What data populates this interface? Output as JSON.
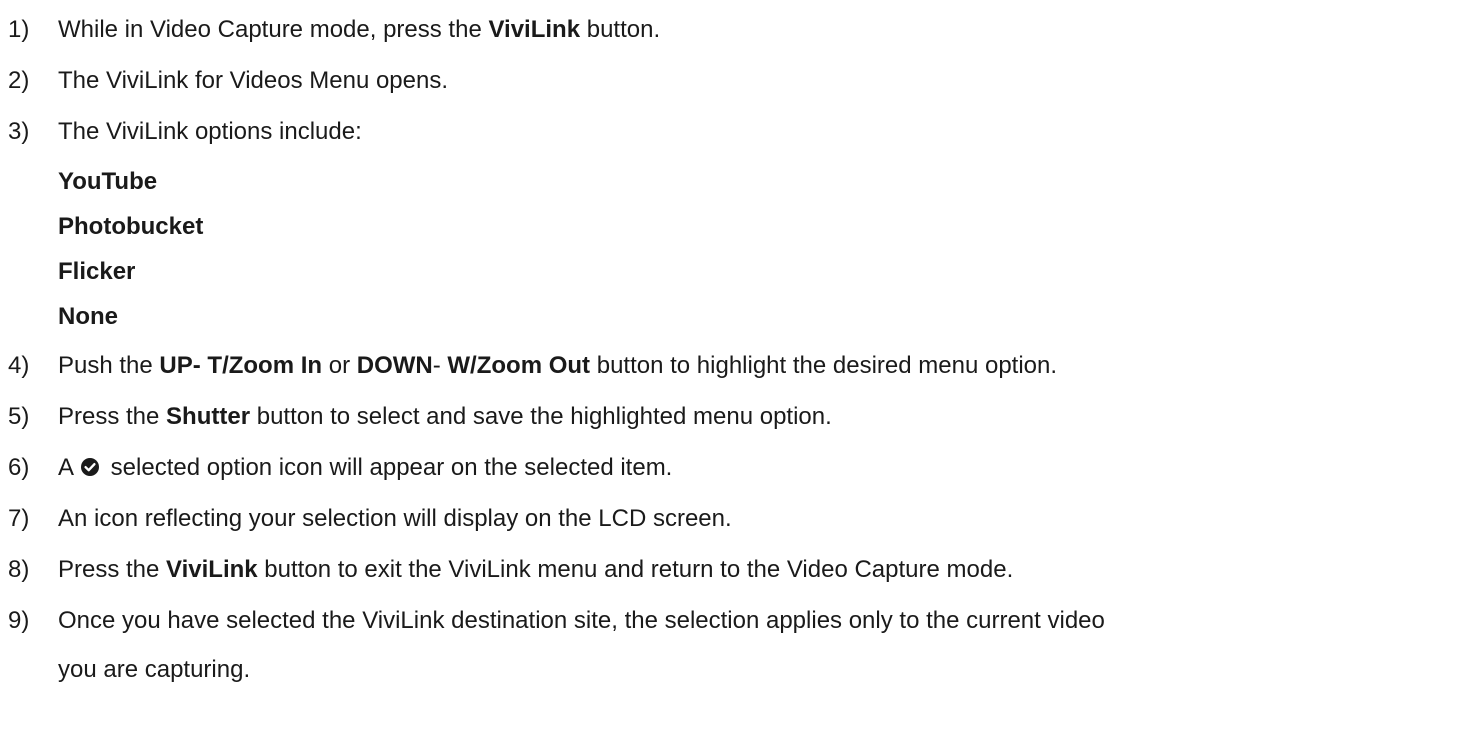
{
  "steps": [
    {
      "num": "1)",
      "parts": [
        "While in Video Capture mode, press the ",
        "ViviLink",
        " button."
      ]
    },
    {
      "num": "2)",
      "text": "The ViviLink for Videos Menu opens."
    },
    {
      "num": "3)",
      "text": "The ViviLink options include:"
    },
    {
      "num": "4)",
      "parts": [
        "Push the ",
        "UP- T/Zoom In",
        " or ",
        "DOWN",
        "- ",
        "W/Zoom Out",
        " button to highlight the desired menu option."
      ]
    },
    {
      "num": "5)",
      "parts": [
        "Press the ",
        "Shutter",
        " button to select and save the highlighted menu option."
      ]
    },
    {
      "num": "6)",
      "before": "A",
      "after": " selected option icon will appear on the selected item.",
      "icon": "check-circle-icon"
    },
    {
      "num": "7)",
      "text": "An icon reflecting your selection will display on the LCD screen."
    },
    {
      "num": "8)",
      "parts": [
        "Press the ",
        "ViviLink",
        " button to exit the ViviLink menu and return to the Video Capture mode."
      ]
    },
    {
      "num": "9)",
      "text": "Once you have selected the ViviLink destination site, the selection applies only to the current video",
      "continuation": "you are capturing."
    }
  ],
  "options": [
    "YouTube",
    "Photobucket",
    "Flicker",
    "None"
  ]
}
